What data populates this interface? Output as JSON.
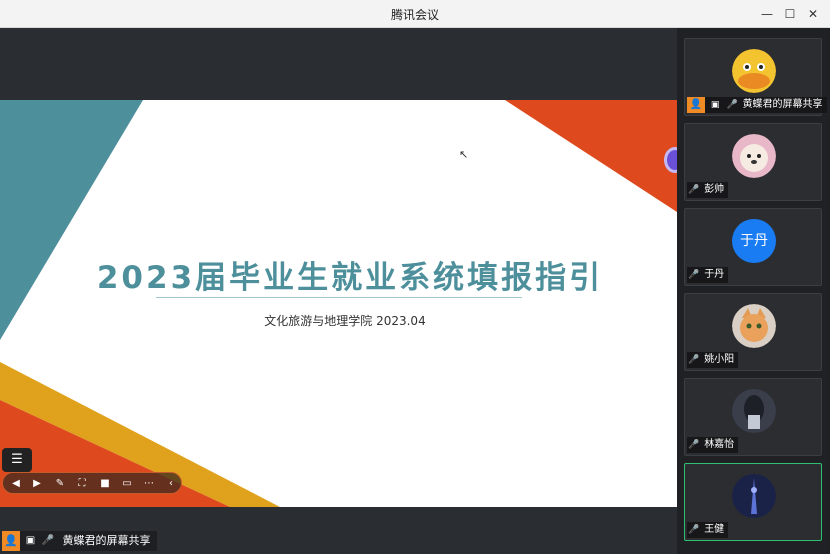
{
  "window": {
    "title": "腾讯会议",
    "minimize": "—",
    "maximize": "☐",
    "close": "✕"
  },
  "slide": {
    "title": "2023届毕业生就业系统填报指引",
    "subtitle": "文化旅游与地理学院  2023.04",
    "colors": {
      "teal": "#4e8f9c",
      "orange": "#de4a1e",
      "gold": "#e0a21c"
    }
  },
  "presenter_label": "黄蝶君的屏幕共享",
  "participants": [
    {
      "name": "黄蝶君的屏幕共享",
      "avatar": "duck-avatar",
      "mic": "on",
      "host": true
    },
    {
      "name": "彭帅",
      "avatar": "dog-avatar",
      "mic": "on"
    },
    {
      "name": "于丹",
      "avatar_text": "于丹",
      "mic": "muted"
    },
    {
      "name": "姚小阳",
      "avatar": "cat-avatar",
      "mic": "muted"
    },
    {
      "name": "林嘉怡",
      "avatar": "photo-avatar",
      "mic": "muted"
    },
    {
      "name": "王健",
      "avatar": "tower-avatar",
      "mic": "speaking",
      "active": true
    }
  ]
}
